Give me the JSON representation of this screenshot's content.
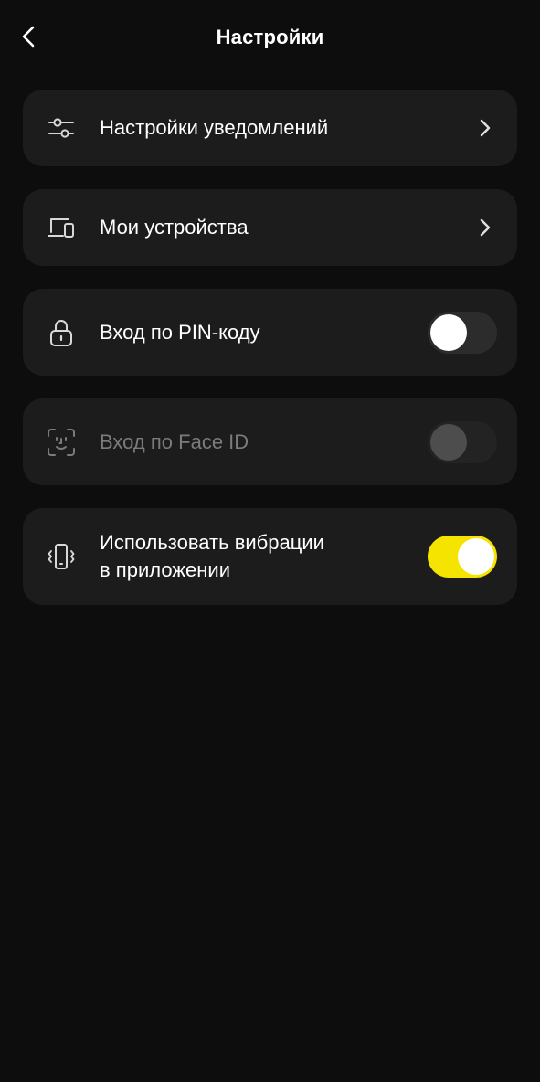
{
  "header": {
    "title": "Настройки",
    "back_icon": "chevron-left-icon"
  },
  "items": [
    {
      "icon": "sliders-icon",
      "label": "Настройки уведомлений",
      "control": "chevron"
    },
    {
      "icon": "devices-icon",
      "label": "Мои устройства",
      "control": "chevron"
    },
    {
      "icon": "lock-icon",
      "label": "Вход по PIN-коду",
      "control": "toggle",
      "toggle_on": false
    },
    {
      "icon": "face-id-icon",
      "label": "Вход по Face ID",
      "control": "toggle",
      "toggle_on": false,
      "disabled": true
    },
    {
      "icon": "phone-vibration-icon",
      "label_line1": "Использовать вибрации",
      "label_line2": "в приложении",
      "control": "toggle",
      "toggle_on": true
    }
  ],
  "colors": {
    "background": "#0d0d0d",
    "card": "#1c1c1c",
    "accent": "#f5e400",
    "disabled_text": "#7b7b7b"
  }
}
